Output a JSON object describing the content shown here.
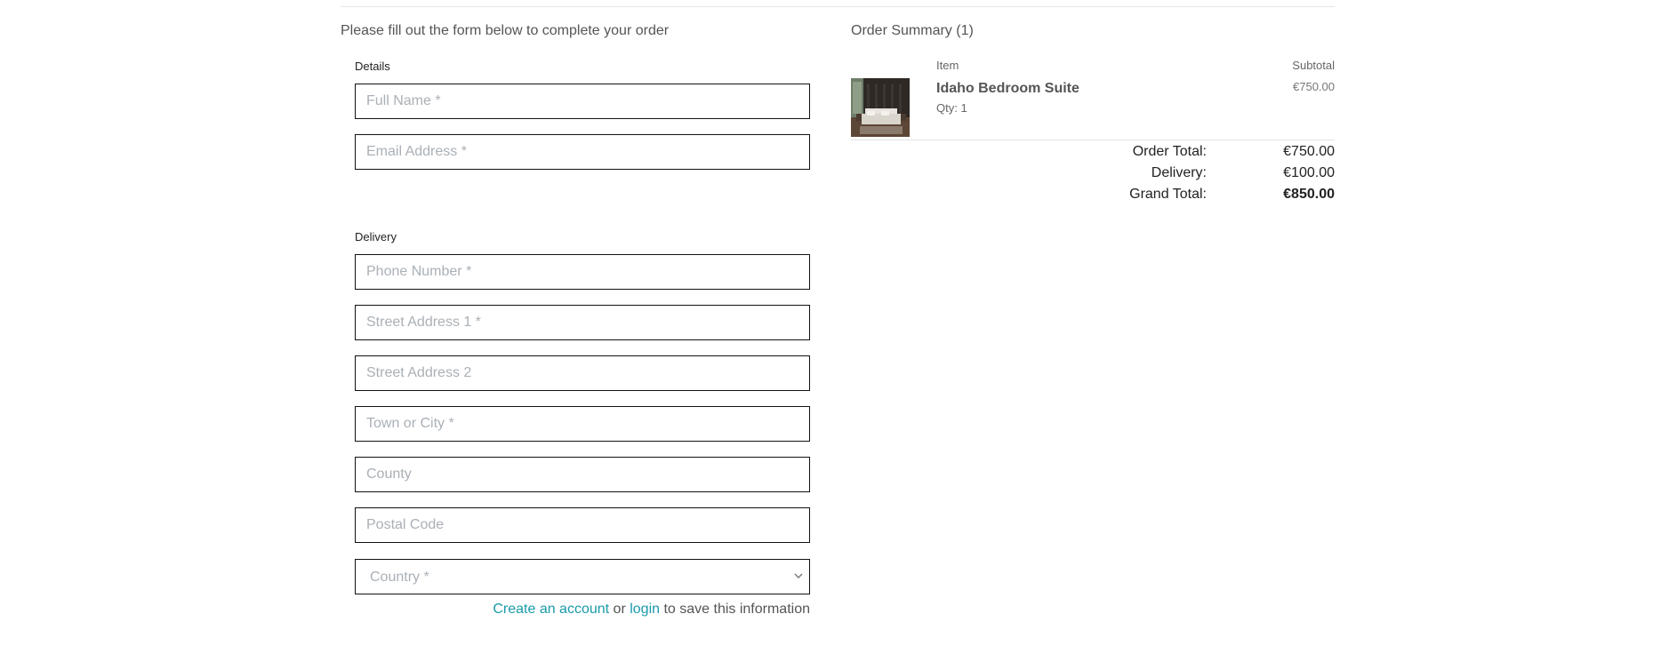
{
  "checkout_form": {
    "intro": "Please fill out the form below to complete your order",
    "details": {
      "legend": "Details",
      "full_name_placeholder": "Full Name *",
      "email_placeholder": "Email Address *"
    },
    "delivery": {
      "legend": "Delivery",
      "phone_placeholder": "Phone Number *",
      "street1_placeholder": "Street Address 1 *",
      "street2_placeholder": "Street Address 2",
      "town_placeholder": "Town or City *",
      "county_placeholder": "County",
      "postcode_placeholder": "Postal Code",
      "country_selected": "Country *"
    },
    "save_info": {
      "create_account_link": "Create an account",
      "or_text": " or ",
      "login_link": "login",
      "suffix_text": " to save this information"
    }
  },
  "order_summary": {
    "title": "Order Summary (1)",
    "column_item": "Item",
    "column_subtotal": "Subtotal",
    "items": [
      {
        "name": "Idaho Bedroom Suite",
        "qty": "Qty: 1",
        "subtotal": "€750.00",
        "image_icon": "bedroom-photo"
      }
    ],
    "order_total_label": "Order Total:",
    "order_total_value": "€750.00",
    "delivery_label": "Delivery:",
    "delivery_value": "€100.00",
    "grand_total_label": "Grand Total:",
    "grand_total_value": "€850.00"
  },
  "colors": {
    "link": "#1a9aaa",
    "field_border": "#111111",
    "placeholder": "#aab0b6",
    "body_text": "#555555"
  }
}
